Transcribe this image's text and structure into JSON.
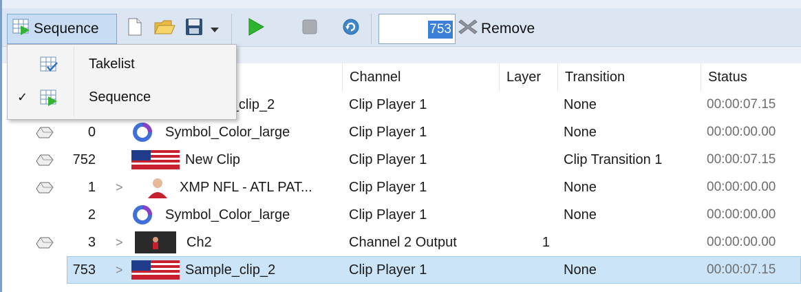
{
  "toolbar": {
    "sequence_label": "Sequence",
    "counter_value": "753",
    "remove_label": "Remove",
    "icons": [
      "sequence-icon",
      "new-file-icon",
      "open-folder-icon",
      "save-icon",
      "dropdown-arrow-icon",
      "play-icon",
      "stop-icon",
      "refresh-icon",
      "remove-x-icon"
    ]
  },
  "menu": {
    "items": [
      {
        "label": "Takelist",
        "checked": false,
        "icon": "takelist-icon"
      },
      {
        "label": "Sequence",
        "checked": true,
        "icon": "sequence-icon"
      }
    ],
    "check_mark": "✓"
  },
  "columns": {
    "channel": "Channel",
    "layer": "Layer",
    "transition": "Transition",
    "status": "Status"
  },
  "rows": [
    {
      "index": "",
      "name": "Sample_clip_2",
      "channel": "Clip Player 1",
      "layer": "",
      "transition": "None",
      "status": "00:00:07.15",
      "gem": true,
      "expander": false,
      "thumb": "flag"
    },
    {
      "index": "0",
      "name": "Symbol_Color_large",
      "channel": "Clip Player 1",
      "layer": "",
      "transition": "None",
      "status": "00:00:00.00",
      "gem": true,
      "expander": false,
      "thumb": "ring"
    },
    {
      "index": "752",
      "name": "New Clip",
      "channel": "Clip Player 1",
      "layer": "",
      "transition": "Clip Transition 1",
      "status": "00:00:07.15",
      "gem": true,
      "expander": false,
      "thumb": "flag"
    },
    {
      "index": "1",
      "name": "XMP NFL - ATL PAT...",
      "channel": "Clip Player 1",
      "layer": "",
      "transition": "None",
      "status": "00:00:00.00",
      "gem": true,
      "expander": true,
      "thumb": "person"
    },
    {
      "index": "2",
      "name": "Symbol_Color_large",
      "channel": "Clip Player 1",
      "layer": "",
      "transition": "None",
      "status": "00:00:00.00",
      "gem": false,
      "expander": false,
      "thumb": "ring"
    },
    {
      "index": "3",
      "name": "Ch2",
      "channel": "Channel 2 Output",
      "layer": "1",
      "transition": "",
      "status": "00:00:00.00",
      "gem": true,
      "expander": true,
      "thumb": "screen"
    },
    {
      "index": "753",
      "name": "Sample_clip_2",
      "channel": "Clip Player 1",
      "layer": "",
      "transition": "None",
      "status": "00:00:07.15",
      "gem": false,
      "expander": true,
      "thumb": "flag",
      "selected": true
    }
  ],
  "colors": {
    "accent": "#3b7fd8",
    "selection": "#cce4f7",
    "toolbar": "#dbe6f2",
    "play": "#2db52d"
  }
}
